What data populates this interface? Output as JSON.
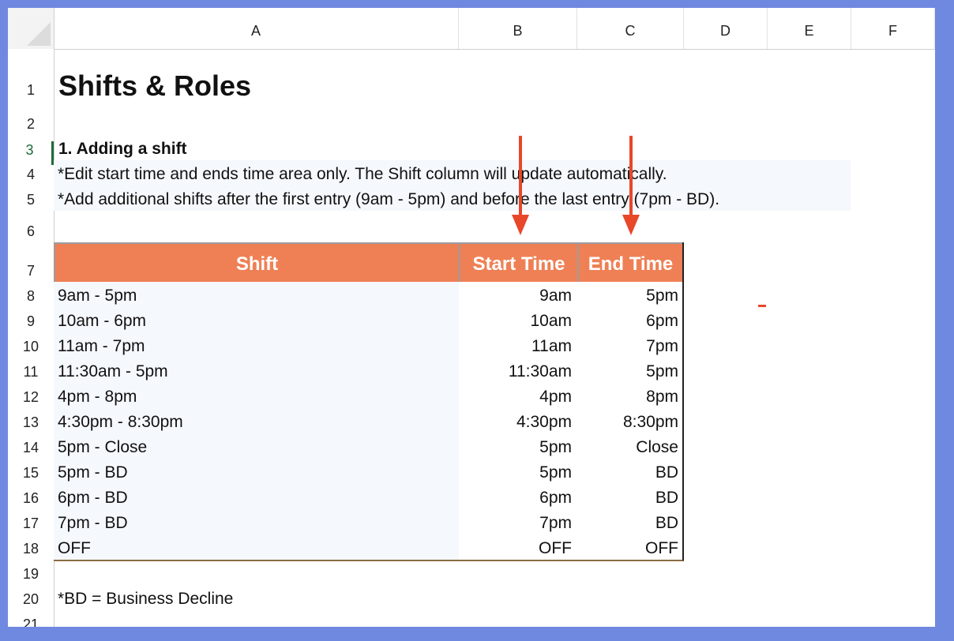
{
  "columns": [
    "A",
    "B",
    "C",
    "D",
    "E",
    "F"
  ],
  "rows": [
    "1",
    "2",
    "3",
    "4",
    "5",
    "6",
    "7",
    "8",
    "9",
    "10",
    "11",
    "12",
    "13",
    "14",
    "15",
    "16",
    "17",
    "18",
    "19",
    "20",
    "21"
  ],
  "title": "Shifts & Roles",
  "section_heading": "1. Adding a shift",
  "note_1": "*Edit start time and ends time area only. The Shift column will update automatically.",
  "note_2": "*Add additional shifts after the first entry (9am - 5pm) and before the last entry (7pm - BD).",
  "table": {
    "headers": {
      "shift": "Shift",
      "start": "Start Time",
      "end": "End Time"
    },
    "rows": [
      {
        "shift": "9am - 5pm",
        "start": "9am",
        "end": "5pm"
      },
      {
        "shift": "10am - 6pm",
        "start": "10am",
        "end": "6pm"
      },
      {
        "shift": "11am - 7pm",
        "start": "11am",
        "end": "7pm"
      },
      {
        "shift": "11:30am - 5pm",
        "start": "11:30am",
        "end": "5pm"
      },
      {
        "shift": "4pm - 8pm",
        "start": "4pm",
        "end": "8pm"
      },
      {
        "shift": "4:30pm - 8:30pm",
        "start": "4:30pm",
        "end": "8:30pm"
      },
      {
        "shift": "5pm - Close",
        "start": "5pm",
        "end": "Close"
      },
      {
        "shift": "5pm - BD",
        "start": "5pm",
        "end": "BD"
      },
      {
        "shift": "6pm - BD",
        "start": "6pm",
        "end": "BD"
      },
      {
        "shift": "7pm - BD",
        "start": "7pm",
        "end": "BD"
      },
      {
        "shift": "OFF",
        "start": "OFF",
        "end": "OFF"
      }
    ]
  },
  "footnote": "*BD = Business Decline",
  "colors": {
    "header_fill": "#ef8055",
    "arrow": "#e8472a",
    "active_row": "#1e6b3a",
    "frame": "#7089e0"
  }
}
